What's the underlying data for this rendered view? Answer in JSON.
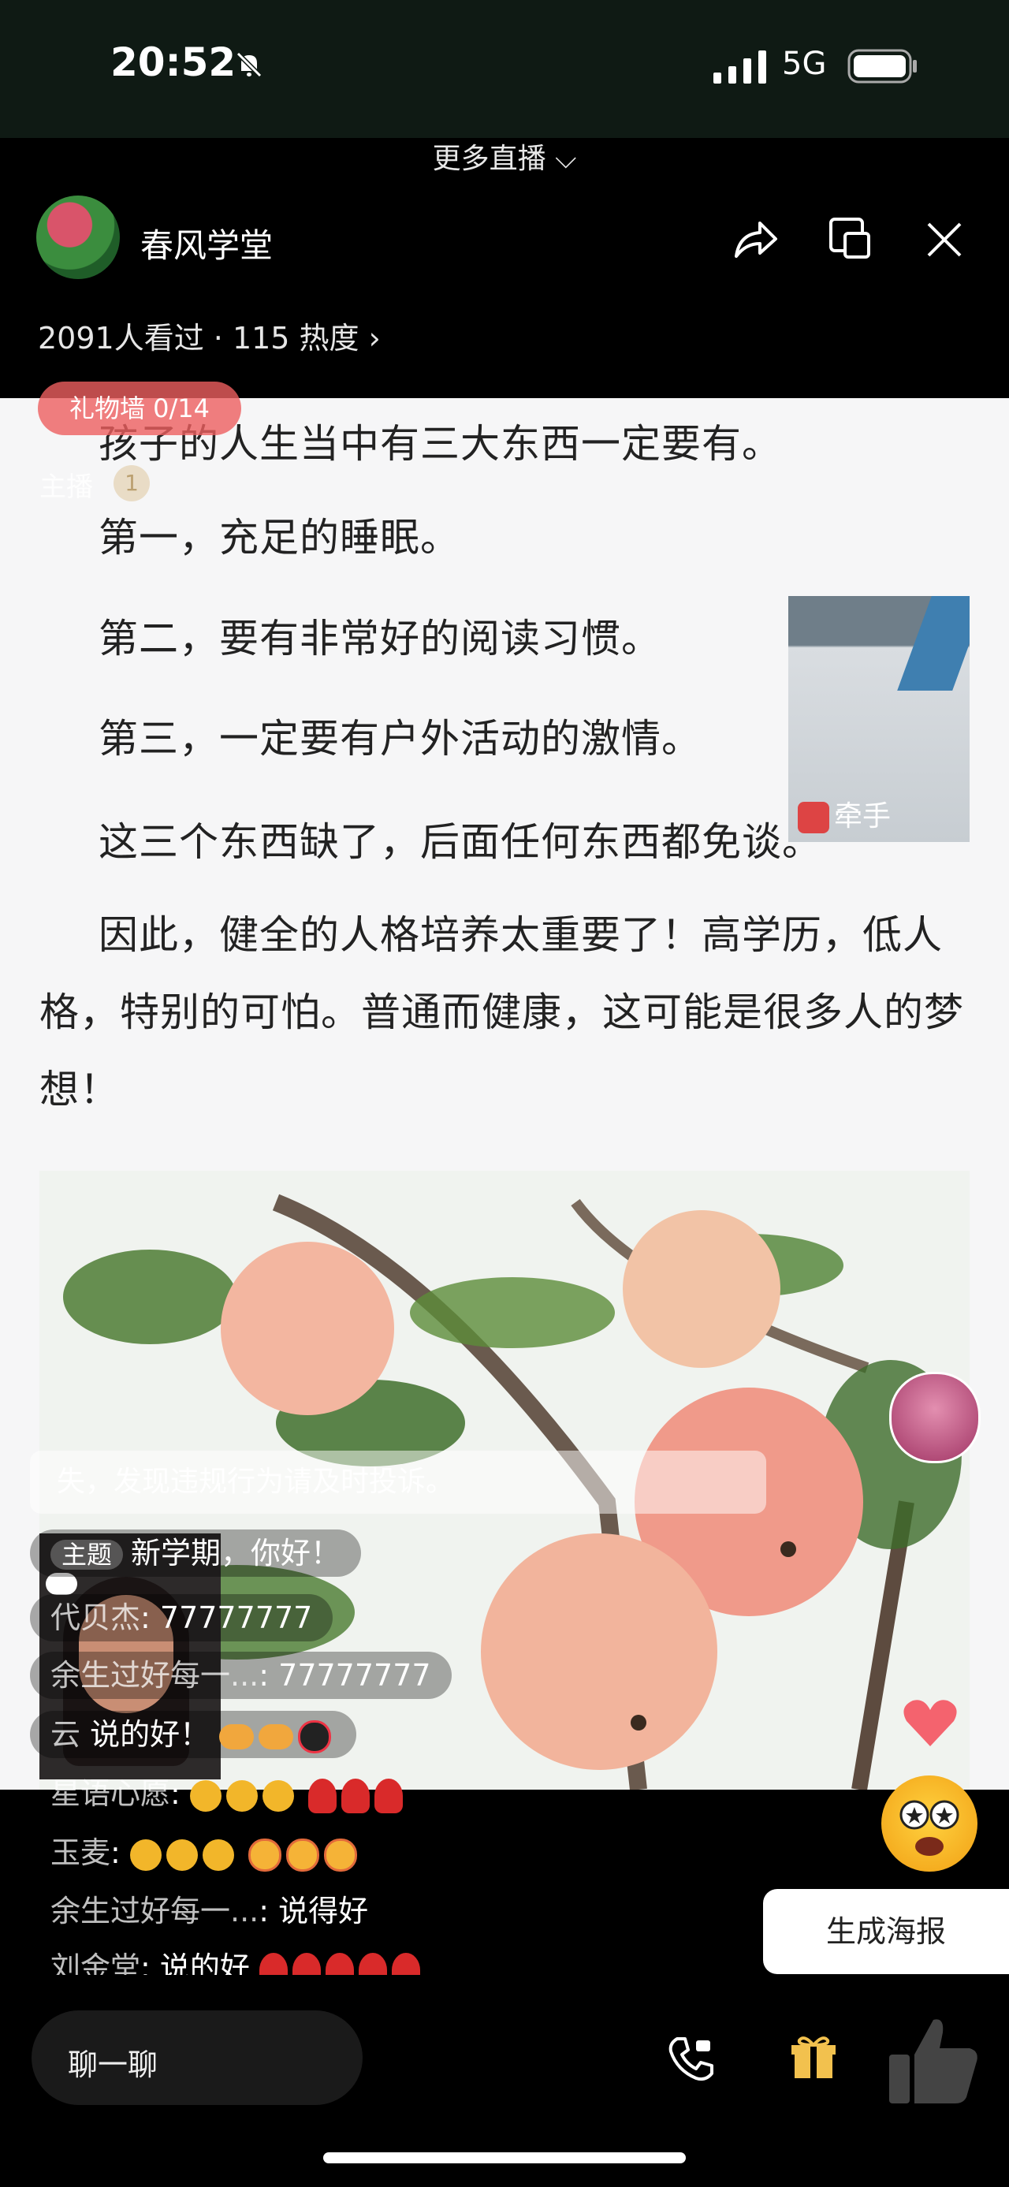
{
  "status_bar": {
    "time": "20:52",
    "network": "5G"
  },
  "top": {
    "more_live": "更多直播 ⌵"
  },
  "header": {
    "channel_name": "春风学堂",
    "stats": "2091人看过 · 115 热度 ›"
  },
  "overlay": {
    "gift_wall": "礼物墙 0/14",
    "host_label": "主播",
    "host_badge": "1"
  },
  "content": {
    "p1": "孩子的人生当中有三大东西一定要有。",
    "p2": "第一，充足的睡眠。",
    "p3": "第二，要有非常好的阅读习惯。",
    "p4": "第三，一定要有户外活动的激情。",
    "p5": "这三个东西缺了，后面任何东西都免谈。",
    "p6": "因此，健全的人格培养太重要了！高学历，低人格，特别的可怕。普通而健康，这可能是很多人的梦想！"
  },
  "guest": {
    "name": "牵手"
  },
  "chat": {
    "notice": "失，发现违规行为请及时投诉。",
    "topic": {
      "tag": "主题",
      "text": "新学期，你好！"
    },
    "messages": [
      {
        "user": "代贝杰",
        "text": "77777777"
      },
      {
        "user": "余生过好每一...",
        "text": "77777777"
      },
      {
        "user": "云",
        "text": "说的好！"
      },
      {
        "user": "星语心愿",
        "text": ""
      },
      {
        "user": "玉麦",
        "text": ""
      },
      {
        "user": "余生过好每一...",
        "text": "说得好"
      },
      {
        "user": "刘金堂",
        "text": "说的好"
      }
    ]
  },
  "poster_button": "生成海报",
  "bottom": {
    "chat_placeholder": "聊一聊"
  },
  "colors": {
    "gift_wall_bg": "#ee5f5f",
    "like_icon": "#444444",
    "gift_icon": "#f2c14e"
  }
}
